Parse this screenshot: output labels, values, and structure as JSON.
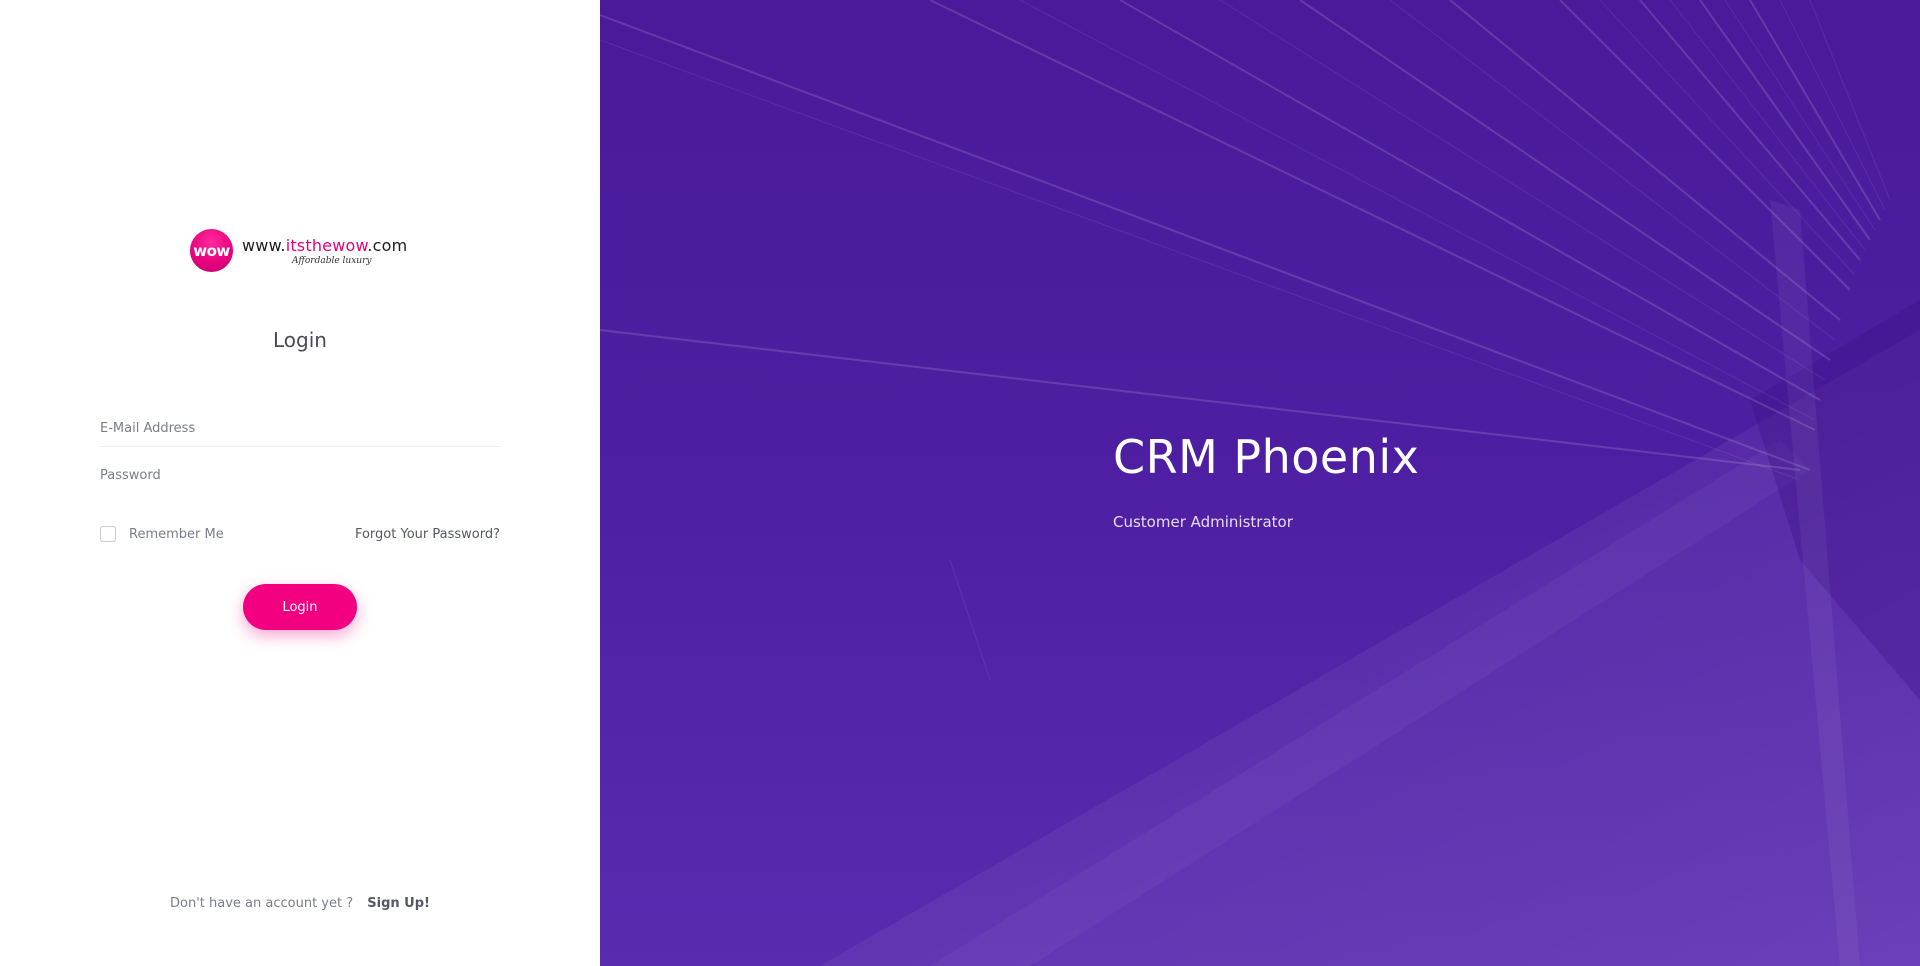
{
  "brand": {
    "badge_text": "wow",
    "url_prefix": "www.",
    "url_highlight": "itsthewow",
    "url_suffix": ".com",
    "tagline": "Affordable luxury",
    "accent_color": "#e6007e"
  },
  "login": {
    "title": "Login",
    "email_placeholder": "E-Mail Address",
    "password_placeholder": "Password",
    "remember_label": "Remember Me",
    "remember_checked": false,
    "forgot_label": "Forgot Your Password?",
    "submit_label": "Login",
    "button_color": "#f2007f"
  },
  "signup": {
    "prompt": "Don't have an account yet ?",
    "link_label": "Sign Up!"
  },
  "hero": {
    "title": "CRM Phoenix",
    "subtitle": "Customer Administrator",
    "background_color": "#4e1ea2"
  }
}
